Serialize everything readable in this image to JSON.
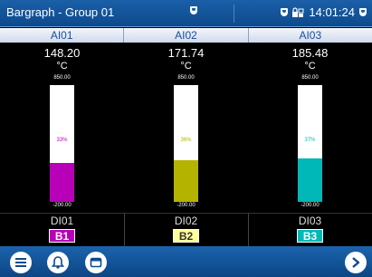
{
  "header": {
    "title": "Bargraph - Group 01",
    "time": "14:01:24"
  },
  "columns": [
    {
      "name": "AI01",
      "value": "148.20",
      "unit": "°C",
      "max": "850.00",
      "min": "-200.00",
      "percent_label": "33%",
      "fill_fraction": 0.33,
      "color": "#b700b7"
    },
    {
      "name": "AI02",
      "value": "171.74",
      "unit": "°C",
      "max": "850.00",
      "min": "-200.00",
      "percent_label": "36%",
      "fill_fraction": 0.36,
      "color": "#b3b300"
    },
    {
      "name": "AI03",
      "value": "185.48",
      "unit": "°C",
      "max": "850.00",
      "min": "-200.00",
      "percent_label": "37%",
      "fill_fraction": 0.37,
      "color": "#00b8b8"
    }
  ],
  "digital": [
    {
      "name": "DI01",
      "badge": "B1",
      "badge_bg": "#b700b7",
      "badge_fg": "#ffffff"
    },
    {
      "name": "DI02",
      "badge": "B2",
      "badge_bg": "#ffff99",
      "badge_fg": "#333333"
    },
    {
      "name": "DI03",
      "badge": "B3",
      "badge_bg": "#00b8b8",
      "badge_fg": "#ffffff"
    }
  ],
  "toolbar": {
    "icons": [
      "list-menu-icon",
      "alarm-bell-icon",
      "window-icon",
      "next-arrow-icon"
    ]
  }
}
